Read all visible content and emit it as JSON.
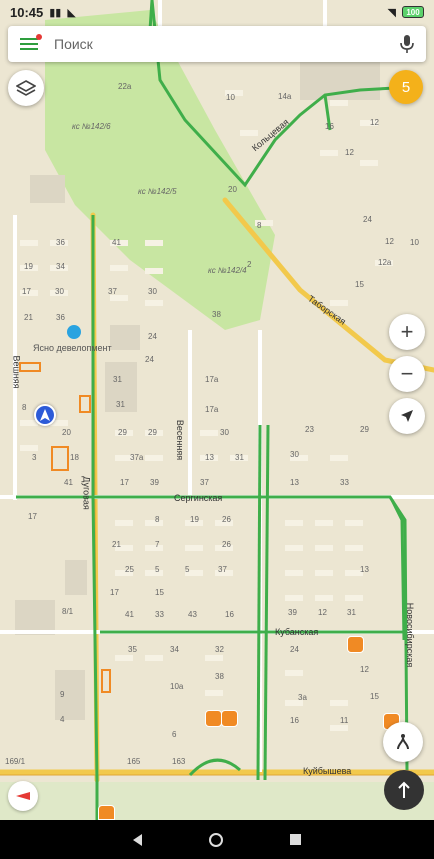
{
  "status_bar": {
    "time": "10:45",
    "battery": "100"
  },
  "search": {
    "placeholder": "Поиск"
  },
  "badge_count": "5",
  "map": {
    "areas": [
      "кс №142/6",
      "кс №142/5",
      "кс №142/4"
    ],
    "streets": [
      "Таборская",
      "Сергинская",
      "Куйбышева",
      "Кольцевая",
      "Весенняя",
      "Дуговая",
      "Кубанская",
      "Новосибирская",
      "Вешняя"
    ],
    "business": "Ясно девелопмент",
    "house_numbers": [
      "22а",
      "10",
      "14а",
      "12",
      "16",
      "20",
      "12",
      "10",
      "8",
      "24",
      "12",
      "12а",
      "15",
      "2",
      "36",
      "41",
      "19",
      "34",
      "17",
      "30",
      "24",
      "38",
      "21",
      "36",
      "37",
      "30",
      "31",
      "31",
      "8",
      "29",
      "17а",
      "24",
      "29",
      "17а",
      "3",
      "20",
      "13",
      "23",
      "29",
      "31",
      "18",
      "37а",
      "30",
      "41",
      "17",
      "39",
      "37",
      "13",
      "33",
      "30",
      "17",
      "21",
      "8",
      "7",
      "5",
      "26",
      "19",
      "25",
      "13",
      "37",
      "5",
      "17",
      "15",
      "43",
      "8/1",
      "26",
      "41",
      "33",
      "16",
      "39",
      "12",
      "31",
      "35",
      "34",
      "32",
      "24",
      "10а",
      "9",
      "12",
      "15",
      "38",
      "3а",
      "11",
      "6",
      "4",
      "16",
      "165",
      "163",
      "169/1"
    ],
    "pin_count": 5
  },
  "controls": {
    "zoom_in": "+",
    "zoom_out": "−"
  }
}
